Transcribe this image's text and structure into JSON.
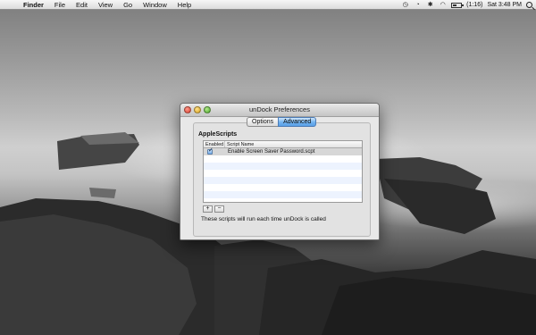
{
  "menubar": {
    "apple": "",
    "app_name": "Finder",
    "items": [
      "File",
      "Edit",
      "View",
      "Go",
      "Window",
      "Help"
    ],
    "battery_text": "(1:16)",
    "clock": "Sat 3:48 PM",
    "battery_level": 0.5,
    "tray_icons": [
      "timemachine-icon",
      "clock-icon",
      "bluetooth-icon",
      "wifi-icon",
      "battery-icon",
      "spotlight-icon"
    ]
  },
  "window": {
    "title": "unDock Preferences",
    "tabs": [
      {
        "label": "Options",
        "selected": false
      },
      {
        "label": "Advanced",
        "selected": true
      }
    ],
    "section_title": "AppleScripts",
    "table": {
      "columns": [
        "Enabled",
        "Script Name"
      ],
      "rows": [
        {
          "enabled": true,
          "name": "Enable Screen Saver Password.scpt"
        }
      ]
    },
    "add_label": "+",
    "remove_label": "−",
    "note": "These scripts will run each time unDock is called"
  },
  "colors": {
    "selected_tab": "#6fb1ef",
    "close": "#d9402f",
    "minimize": "#d9a21f",
    "zoom": "#4aa52c"
  }
}
